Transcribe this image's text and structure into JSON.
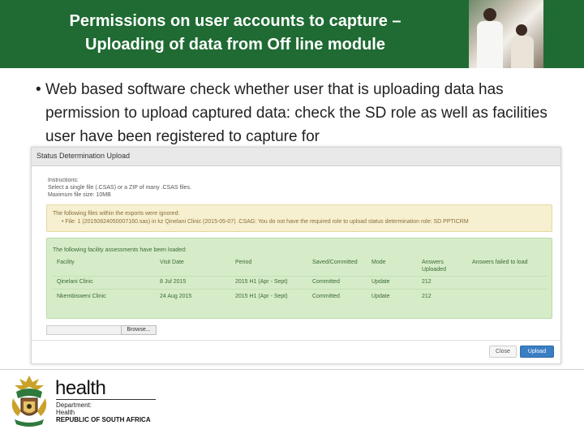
{
  "header": {
    "title_line1": "Permissions on user accounts to capture –",
    "title_line2": "Uploading of data from Off line module"
  },
  "bullet": {
    "marker": "•",
    "text": "Web based software check whether user that is uploading data has permission to upload captured data: check the SD role as well as  facilities user have been registered to capture for"
  },
  "dialog": {
    "title": "Status Determination Upload",
    "instructions_label": "Instructions:",
    "instructions_line1": "Select a single file (.CSAS) or a ZIP of many .CSAS files.",
    "instructions_line2": "Maximum file size: 10MB",
    "warning": {
      "heading": "The following files within the exports were ignored:",
      "item": "• File: 1 (20150824050007160.sas) in kz Qinelani Clinic (2015-05-07) .CSAG: You do not have the required role to upload status determination role: SD PPTICRM"
    },
    "success": {
      "heading": "The following facility assessments have been loaded:",
      "columns": [
        "Facility",
        "Visit Date",
        "Period",
        "Saved/Committed",
        "Mode",
        "Answers Uploaded",
        "Answers failed to load"
      ],
      "rows": [
        [
          "Qinelani Clinic",
          "8 Jul 2015",
          "2015 H1 (Apr - Sept)",
          "Committed",
          "Update",
          "212",
          ""
        ],
        [
          "Nkembisweni Clinic",
          "24 Aug 2015",
          "2015 H1 (Apr - Sept)",
          "Committed",
          "Update",
          "212",
          ""
        ]
      ]
    },
    "browse_label": "Browse...",
    "close_label": "Close",
    "upload_label": "Upload"
  },
  "logo": {
    "word": "health",
    "line1": "Department:",
    "line2": "Health",
    "line3": "REPUBLIC OF SOUTH AFRICA"
  },
  "colors": {
    "header_green": "#1f6b33",
    "warning_bg": "#f6f0d0",
    "success_bg": "#d6ecc9",
    "upload_blue": "#3a7fc4"
  }
}
